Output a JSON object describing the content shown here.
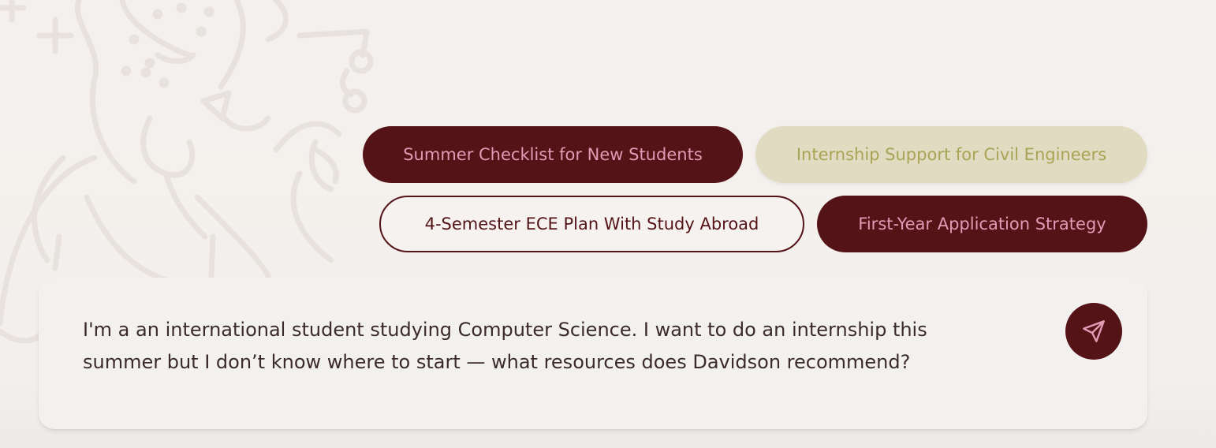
{
  "colors": {
    "accent_dark": "#541317",
    "accent_pink": "#e39ab5",
    "olive_bg": "#e0dbc1",
    "olive_text": "#a9a356",
    "page_bg": "#f3efec",
    "composer_bg": "#f2f1ef",
    "text_dark": "#3b2a2a"
  },
  "suggestions": [
    {
      "label": "Summer Checklist for New Students",
      "style": "dark"
    },
    {
      "label": "Internship Support for Civil Engineers",
      "style": "olive"
    },
    {
      "label": "4-Semester ECE Plan With Study Abroad",
      "style": "outline"
    },
    {
      "label": "First-Year Application Strategy",
      "style": "dark"
    }
  ],
  "composer": {
    "text": "I'm a an international student studying Computer Science. I want to do an internship this summer but I don’t know where to start — what resources does Davidson recommend?",
    "send_icon": "send-icon"
  },
  "background": {
    "illustration": "line-art-wildcat-mascot"
  }
}
